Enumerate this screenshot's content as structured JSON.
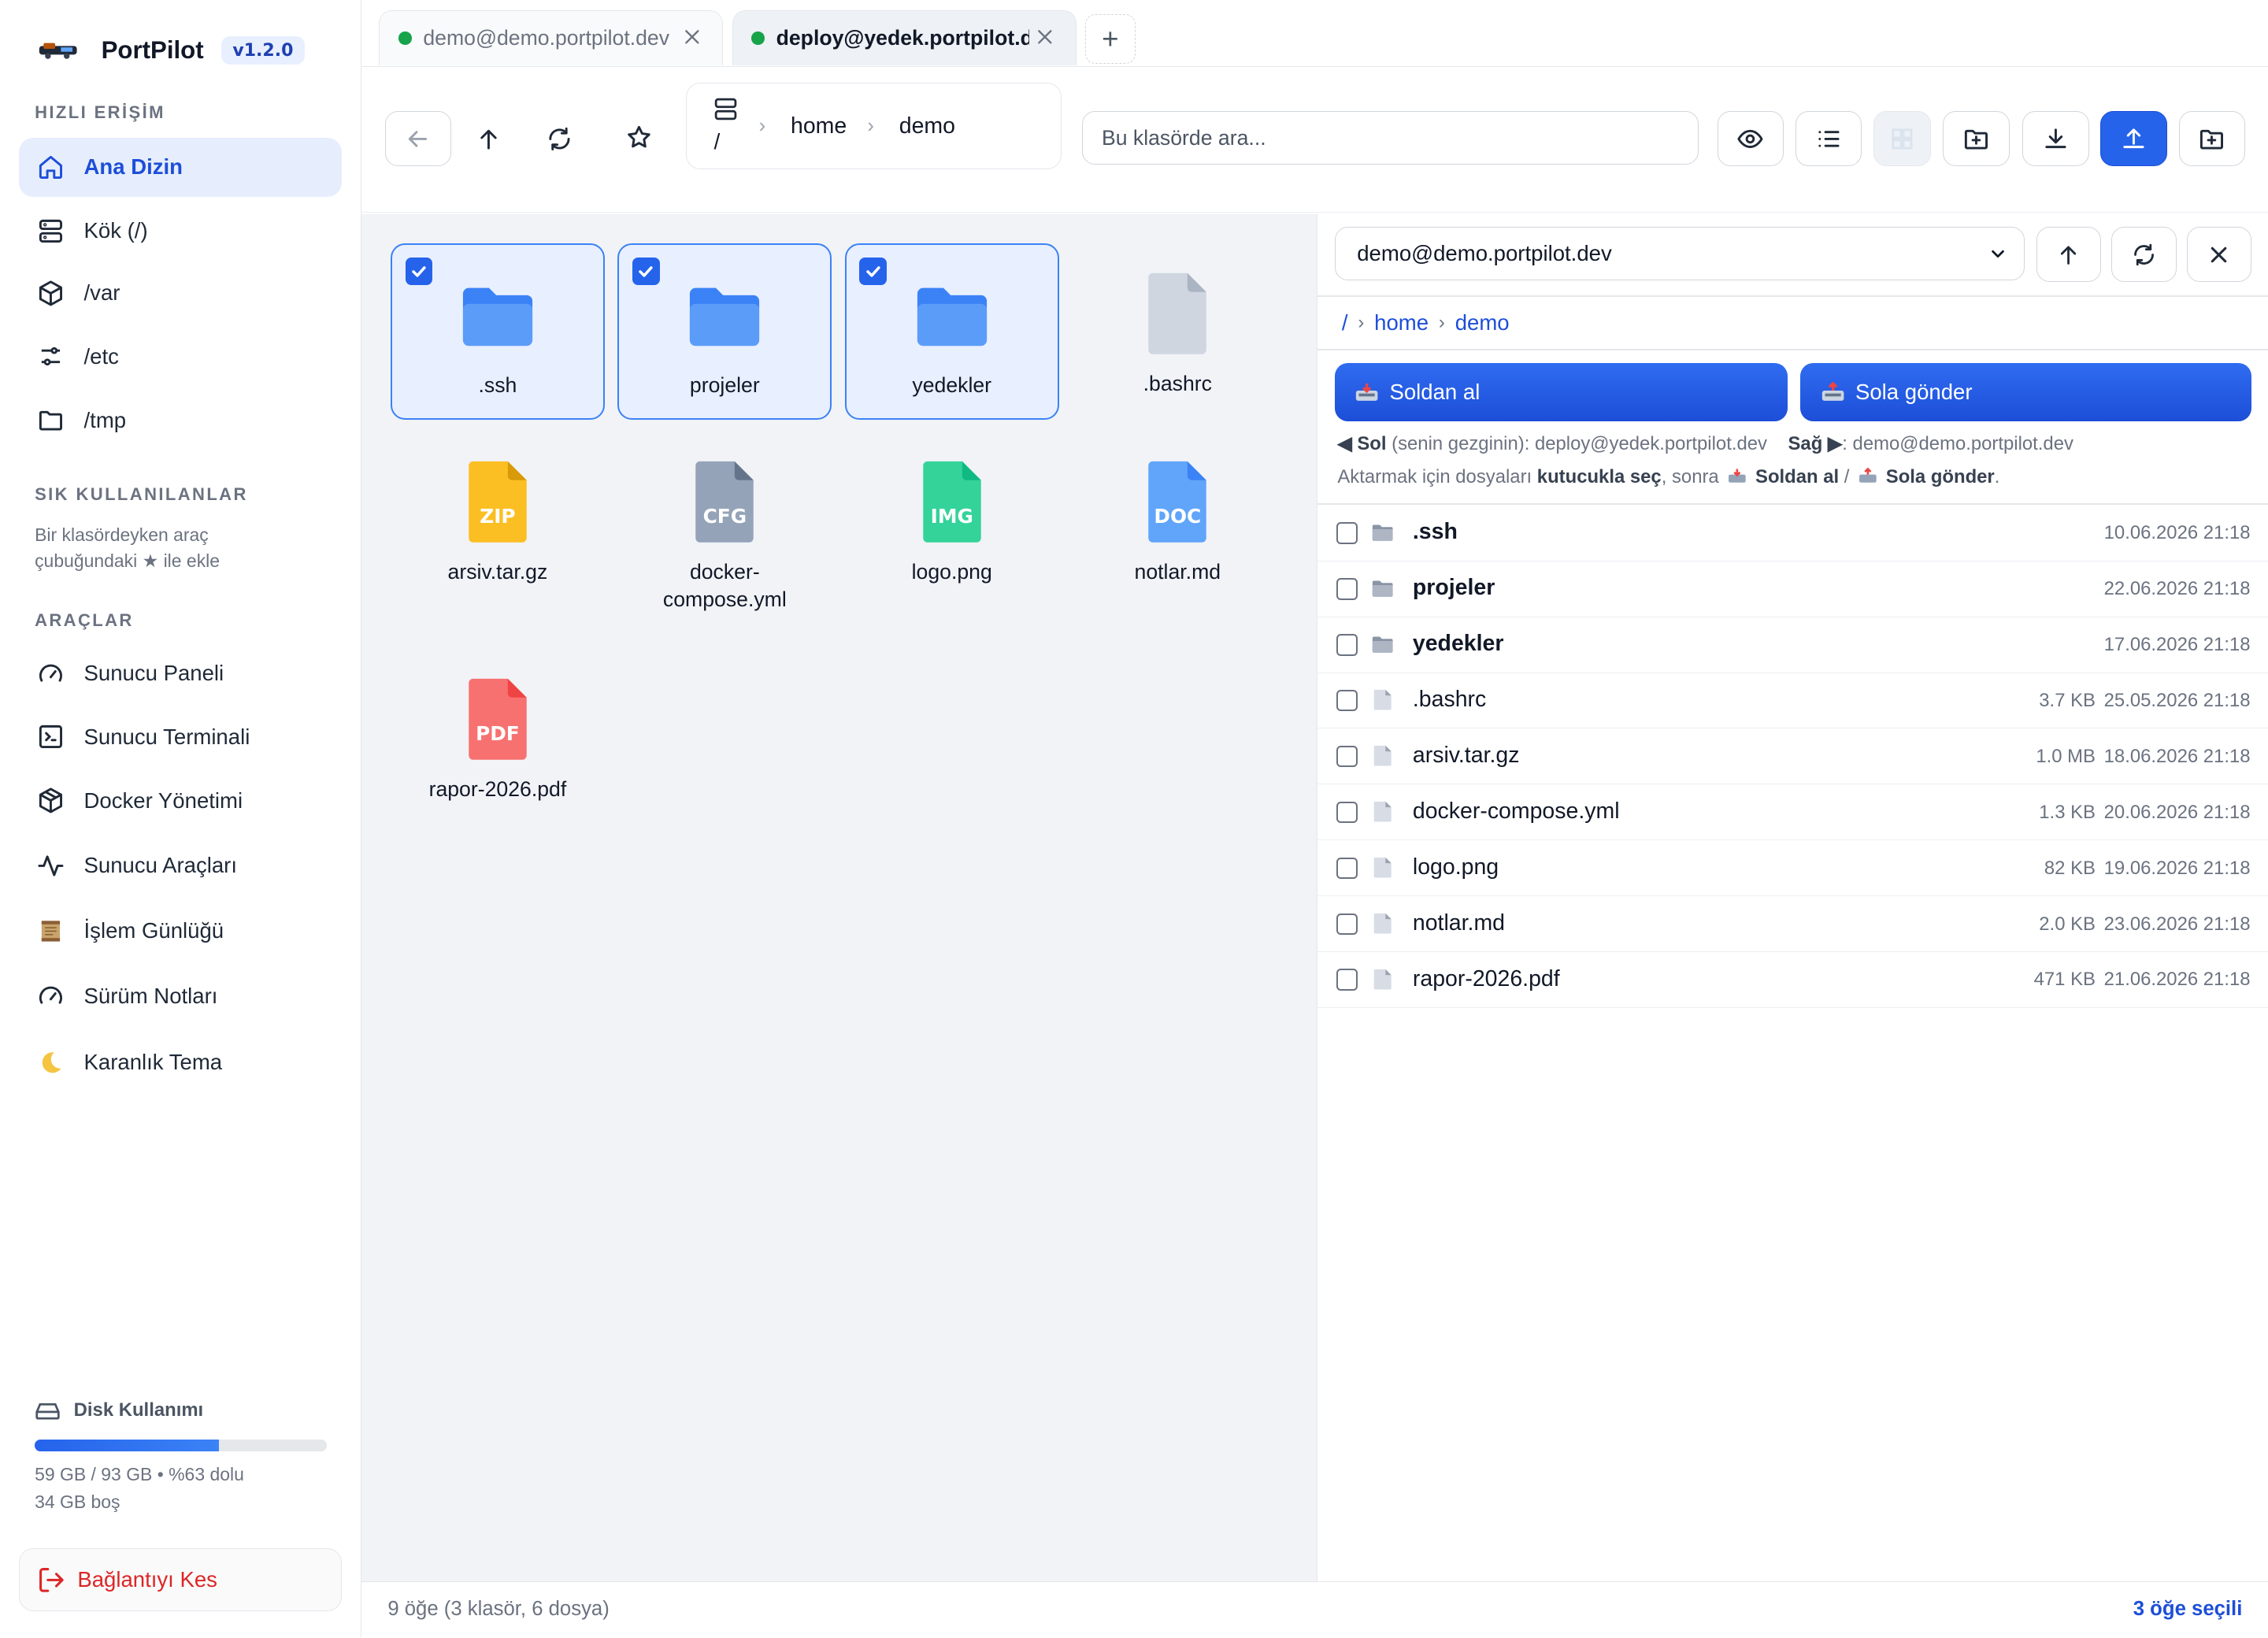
{
  "app": {
    "name": "PortPilot",
    "version": "v1.2.0"
  },
  "sidebar": {
    "quick_title": "HIZLI ERİŞİM",
    "quick": [
      {
        "label": "Ana Dizin",
        "icon": "home-icon",
        "active": true
      },
      {
        "label": "Kök (/)",
        "icon": "server-icon"
      },
      {
        "label": "/var",
        "icon": "box-icon"
      },
      {
        "label": "/etc",
        "icon": "sliders-icon"
      },
      {
        "label": "/tmp",
        "icon": "folder-icon"
      }
    ],
    "fav_title": "SIK KULLANILANLAR",
    "fav_hint": "Bir klasördeyken araç çubuğundaki ★ ile ekle",
    "tools_title": "ARAÇLAR",
    "tools": [
      {
        "label": "Sunucu Paneli",
        "icon": "gauge-icon"
      },
      {
        "label": "Sunucu Terminali",
        "icon": "terminal-icon"
      },
      {
        "label": "Docker Yönetimi",
        "icon": "cube-icon"
      },
      {
        "label": "Sunucu Araçları",
        "icon": "activity-icon"
      },
      {
        "label": "İşlem Günlüğü",
        "icon": "scroll-icon"
      },
      {
        "label": "Sürüm Notları",
        "icon": "gauge-icon"
      },
      {
        "label": "Karanlık Tema",
        "icon": "moon-icon"
      }
    ],
    "disk": {
      "title": "Disk Kullanımı",
      "used_fraction": 0.63,
      "line1": "59 GB / 93 GB • %63 dolu",
      "line2": "34 GB boş"
    },
    "disconnect_label": "Bağlantıyı Kes"
  },
  "tabs": [
    {
      "title": "demo@demo.portpilot.dev",
      "active": false
    },
    {
      "title": "deploy@yedek.portpilot.dev",
      "active": true
    }
  ],
  "tab_add": "+",
  "toolbar": {
    "breadcrumb": {
      "root": "/",
      "items": [
        "home",
        "demo"
      ],
      "separator": "›"
    },
    "search_placeholder": "Bu klasörde ara..."
  },
  "left_files": [
    {
      "name": ".ssh",
      "type": "folder",
      "selected": true
    },
    {
      "name": "projeler",
      "type": "folder",
      "selected": true
    },
    {
      "name": "yedekler",
      "type": "folder",
      "selected": true
    },
    {
      "name": ".bashrc",
      "type": "file",
      "badge": "",
      "color": "#cfd6e0"
    },
    {
      "name": "arsiv.tar.gz",
      "type": "file",
      "badge": "ZIP",
      "color": "#fbbf24"
    },
    {
      "name": "docker-compose.yml",
      "type": "file",
      "badge": "CFG",
      "color": "#94a3b8"
    },
    {
      "name": "logo.png",
      "type": "file",
      "badge": "IMG",
      "color": "#34d399"
    },
    {
      "name": "notlar.md",
      "type": "file",
      "badge": "DOC",
      "color": "#60a5fa"
    },
    {
      "name": "rapor-2026.pdf",
      "type": "file",
      "badge": "PDF",
      "color": "#f87171"
    }
  ],
  "right_pane": {
    "server": "demo@demo.portpilot.dev",
    "breadcrumb": [
      "/",
      "home",
      "demo"
    ],
    "crumb_sep": "›",
    "pull_label": "Soldan al",
    "push_label": "Sola gönder",
    "info1": {
      "left_label": "◀ Sol",
      "left_desc": "(senin gezginin): deploy@yedek.portpilot.dev",
      "right_label": "Sağ ▶",
      "right_desc": ": demo@demo.portpilot.dev"
    },
    "info2": {
      "a": "Aktarmak için dosyaları ",
      "b": "kutucukla seç",
      "c": ", sonra ",
      "d": "Soldan al",
      "e": " / ",
      "f": "Sola gönder",
      "g": "."
    },
    "rows": [
      {
        "name": ".ssh",
        "dir": true,
        "size": "",
        "date": "10.06.2026 21:18"
      },
      {
        "name": "projeler",
        "dir": true,
        "size": "",
        "date": "22.06.2026 21:18"
      },
      {
        "name": "yedekler",
        "dir": true,
        "size": "",
        "date": "17.06.2026 21:18"
      },
      {
        "name": ".bashrc",
        "dir": false,
        "size": "3.7 KB",
        "date": "25.05.2026 21:18"
      },
      {
        "name": "arsiv.tar.gz",
        "dir": false,
        "size": "1.0 MB",
        "date": "18.06.2026 21:18"
      },
      {
        "name": "docker-compose.yml",
        "dir": false,
        "size": "1.3 KB",
        "date": "20.06.2026 21:18"
      },
      {
        "name": "logo.png",
        "dir": false,
        "size": "82 KB",
        "date": "19.06.2026 21:18"
      },
      {
        "name": "notlar.md",
        "dir": false,
        "size": "2.0 KB",
        "date": "23.06.2026 21:18"
      },
      {
        "name": "rapor-2026.pdf",
        "dir": false,
        "size": "471 KB",
        "date": "21.06.2026 21:18"
      }
    ]
  },
  "status": {
    "left": "9 öğe (3 klasör, 6 dosya)",
    "right": "3 öğe seçili"
  },
  "colors": {
    "accent": "#2563eb",
    "danger": "#dc2626",
    "online": "#16a34a",
    "folder": "#4f8ff7"
  }
}
